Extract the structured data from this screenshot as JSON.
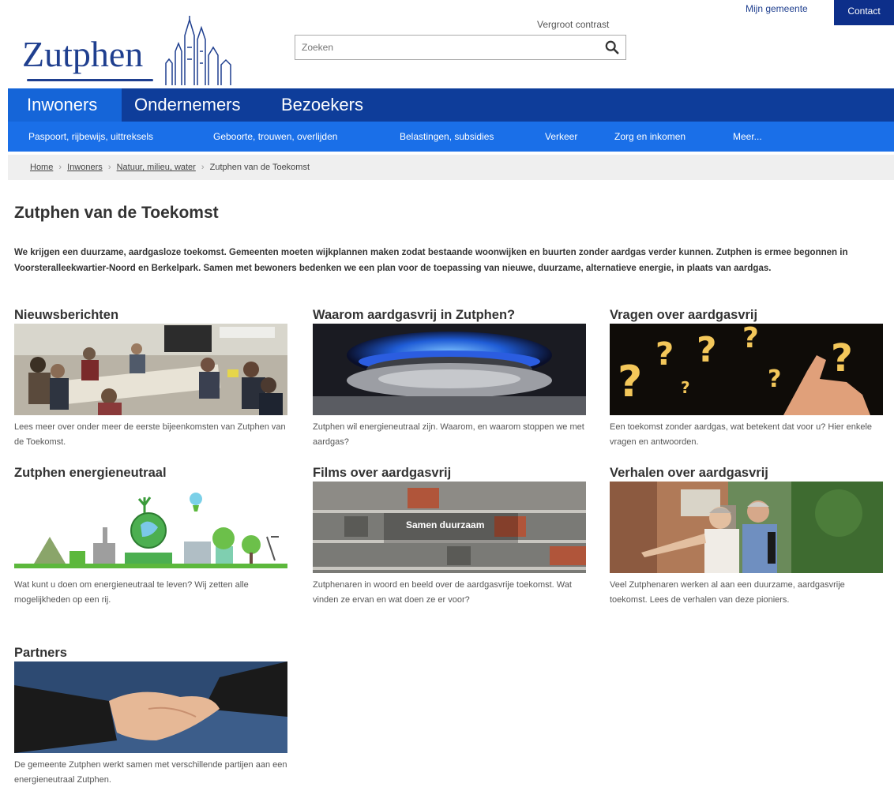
{
  "header": {
    "logo_text": "Zutphen",
    "contrast_link": "Vergroot contrast",
    "search_placeholder": "Zoeken",
    "mijn_gemeente": "Mijn gemeente",
    "contact": "Contact"
  },
  "nav": {
    "tabs": [
      {
        "label": "Inwoners"
      },
      {
        "label": "Ondernemers"
      },
      {
        "label": "Bezoekers"
      }
    ],
    "sub": [
      {
        "label": "Paspoort, rijbewijs, uittreksels"
      },
      {
        "label": "Geboorte, trouwen, overlijden"
      },
      {
        "label": "Belastingen, subsidies"
      },
      {
        "label": "Verkeer"
      },
      {
        "label": "Zorg en inkomen"
      },
      {
        "label": "Meer..."
      }
    ]
  },
  "breadcrumb": {
    "items": [
      "Home",
      "Inwoners",
      "Natuur, milieu, water",
      "Zutphen van de Toekomst"
    ],
    "sep": "›"
  },
  "page": {
    "title": "Zutphen van de Toekomst",
    "intro": "We krijgen een duurzame, aardgasloze toekomst. Gemeenten moeten wijkplannen maken zodat bestaande woonwijken en buurten zonder aardgas verder kunnen. Zutphen is ermee begonnen in Voorsteralleekwartier-Noord en Berkelpark. Samen met bewoners bedenken we een plan voor de toepassing van nieuwe, duurzame, alternatieve energie, in plaats van aardgas."
  },
  "cards": [
    {
      "title": "Nieuwsberichten",
      "text": "Lees meer over onder meer de eerste bijeenkomsten van Zutphen van de Toekomst."
    },
    {
      "title": "Waarom aardgasvrij in Zutphen?",
      "text": "Zutphen wil energieneutraal zijn. Waarom, en waarom stoppen we met aardgas?"
    },
    {
      "title": "Vragen over aardgasvrij",
      "text": "Een toekomst zonder aardgas, wat betekent dat voor u? Hier enkele vragen en antwoorden."
    },
    {
      "title": "Zutphen energieneutraal",
      "text": "Wat kunt u doen om energieneutraal te leven? Wij zetten alle mogelijkheden op een rij."
    },
    {
      "title": "Films over aardgasvrij",
      "text": "Zutphenaren in woord en beeld over de aardgasvrije toekomst. Wat vinden ze ervan en wat doen ze er voor?",
      "image_caption": "Samen duurzaam"
    },
    {
      "title": "Verhalen over aardgasvrij",
      "text": "Veel Zutphenaren werken al aan een duurzame, aardgasvrije toekomst. Lees de verhalen van deze pioniers."
    },
    {
      "title": "Partners",
      "text": "De gemeente Zutphen werkt samen met verschillende partijen aan een energieneutraal Zutphen."
    }
  ],
  "colors": {
    "nav_dark": "#0e3d9a",
    "nav_active": "#1565d8",
    "nav_sub": "#1a6fe8",
    "logo_blue": "#1f3f8f"
  }
}
